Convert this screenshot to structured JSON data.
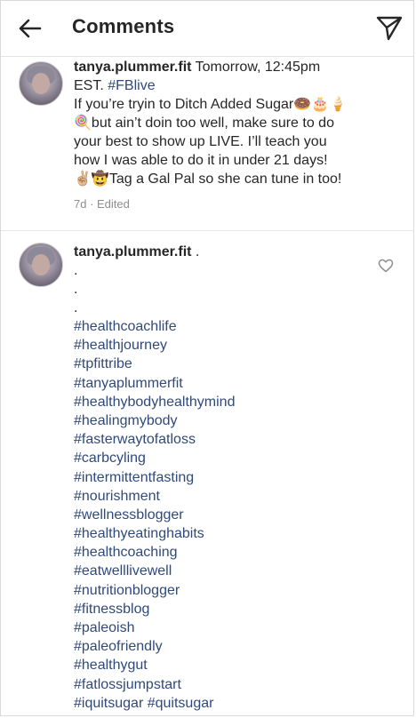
{
  "header": {
    "title": "Comments"
  },
  "caption": {
    "username": "tanya.plummer.fit",
    "text_line1_rest": " Tomorrow, 12:45pm",
    "text_line2_plain": "EST. ",
    "text_line2_tag": "#FBlive",
    "text_line3": "If you’re tryin to Ditch Added Sugar🍩🎂🍦",
    "text_line4": "🍭but ain’t doin too well, make sure to do",
    "text_line5": "your best to show up LIVE. I’ll teach you",
    "text_line6": "how I was able to do it in under 21 days!",
    "text_line7": "✌🏼🤠Tag a Gal Pal so she can tune in too!",
    "meta": "7d · Edited"
  },
  "comment": {
    "username": "tanya.plummer.fit",
    "username_suffix": " .",
    "dots": [
      ".",
      ".",
      "."
    ],
    "hashtags": [
      "#healthcoachlife",
      "#healthjourney",
      "#tpfittribe",
      "#tanyaplummerfit",
      "#healthybodyhealthymind",
      "#healingmybody",
      "#fasterwaytofatloss",
      "#carbcyling",
      "#intermittentfasting",
      "#nourishment",
      "#wellnessblogger",
      "#healthyeatinghabits",
      "#healthcoaching",
      "#eatwelllivewell",
      "#nutritionblogger",
      "#fitnessblog",
      "#paleoish",
      "#paleofriendly",
      "#healthygut",
      "#fatlossjumpstart",
      "#iquitsugar #quitsugar"
    ]
  },
  "icons": {
    "back": "arrow-left-icon",
    "send": "paper-plane-icon",
    "like": "heart-outline-icon"
  }
}
